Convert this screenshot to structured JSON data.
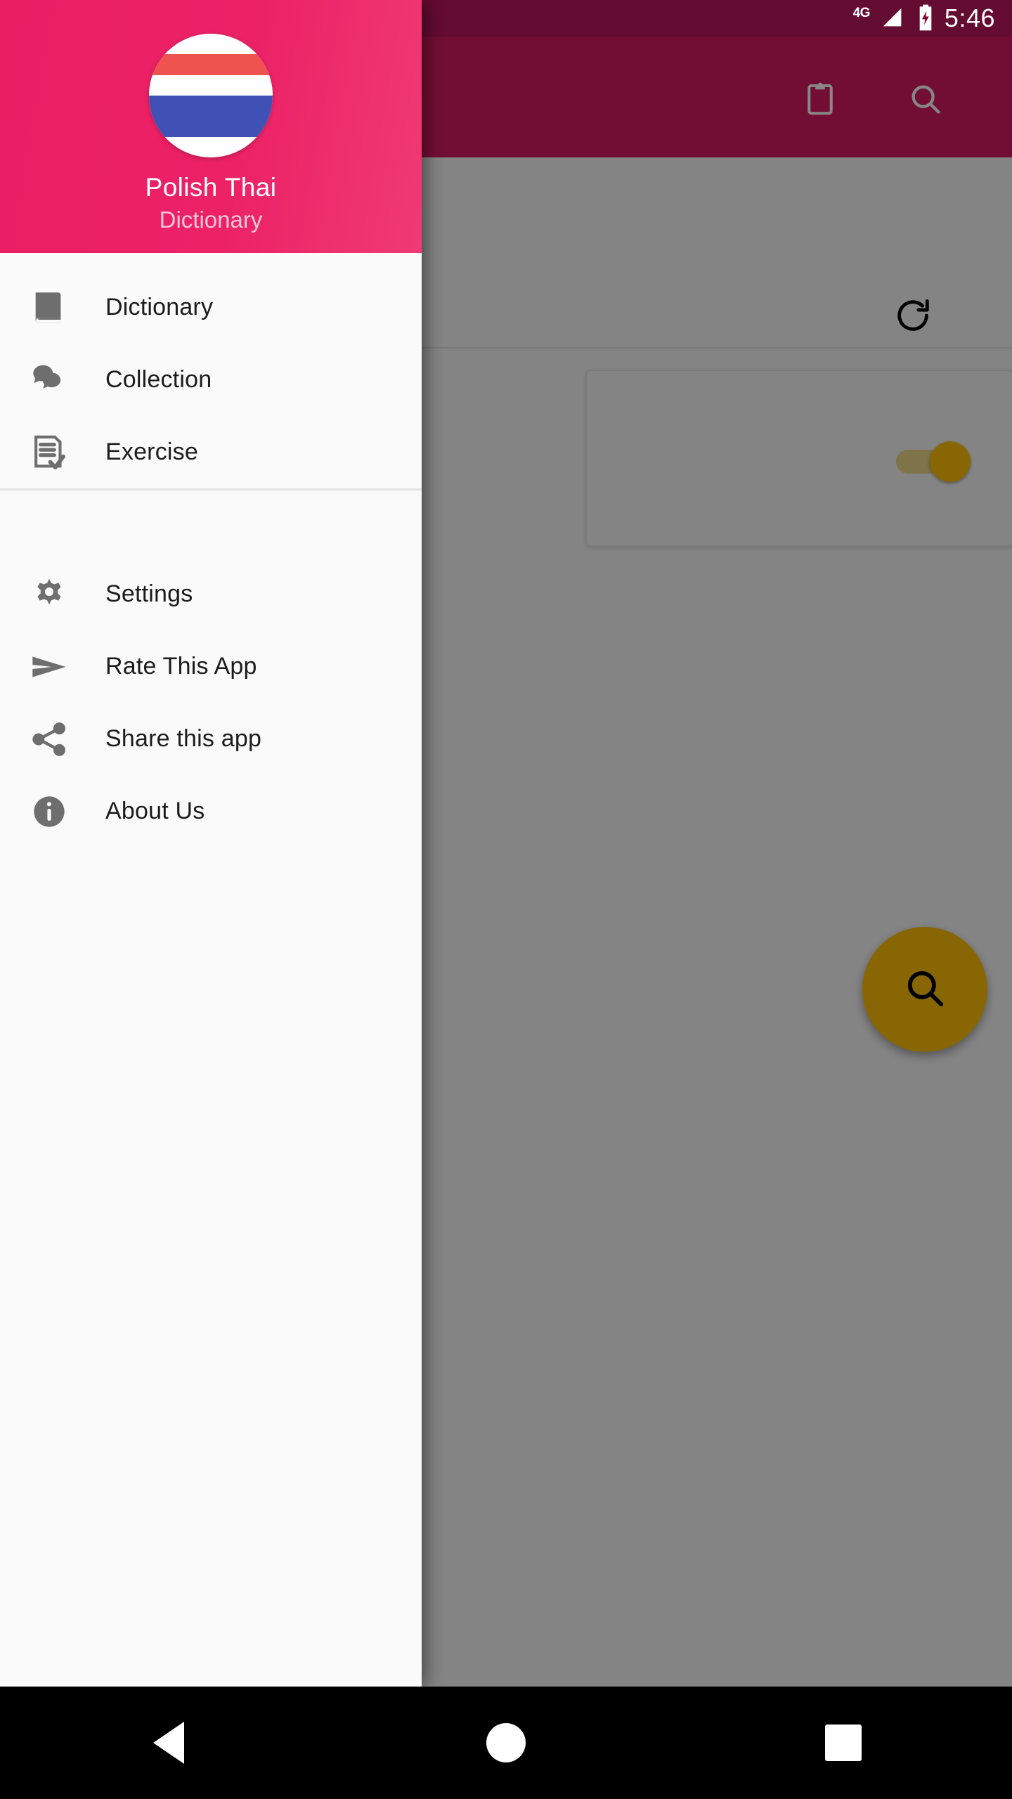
{
  "status_bar": {
    "network": "4G",
    "battery_icon": "battery-charging-icon",
    "signal_icon": "signal-cellular-icon",
    "time": "5:46"
  },
  "background_app": {
    "toolbar": {
      "clipboard_label": "clipboard-icon",
      "search_label": "search-icon"
    },
    "refresh_label": "refresh-icon",
    "card": {
      "switch_state": "on"
    },
    "fab": {
      "icon": "search-icon"
    }
  },
  "drawer": {
    "avatar_icon": "thai-flag-avatar",
    "title": "Polish Thai",
    "subtitle": "Dictionary",
    "primary_items": [
      {
        "label": "Dictionary",
        "icon": "book-icon"
      },
      {
        "label": "Collection",
        "icon": "chat-bubbles-icon"
      },
      {
        "label": "Exercise",
        "icon": "document-check-icon"
      }
    ],
    "secondary_items": [
      {
        "label": "Settings",
        "icon": "gear-icon"
      },
      {
        "label": "Rate This App",
        "icon": "send-icon"
      },
      {
        "label": "Share this app",
        "icon": "share-icon"
      },
      {
        "label": "About Us",
        "icon": "info-icon"
      }
    ]
  },
  "navigation_bar": {
    "back": "back-button",
    "home": "home-button",
    "recents": "recents-button"
  },
  "colors": {
    "primary": "#e91e63",
    "primary_dark": "#ad1457",
    "accent": "#ffc107",
    "drawer_bg": "#fafafa",
    "subtitle": "#f9c6d8"
  }
}
